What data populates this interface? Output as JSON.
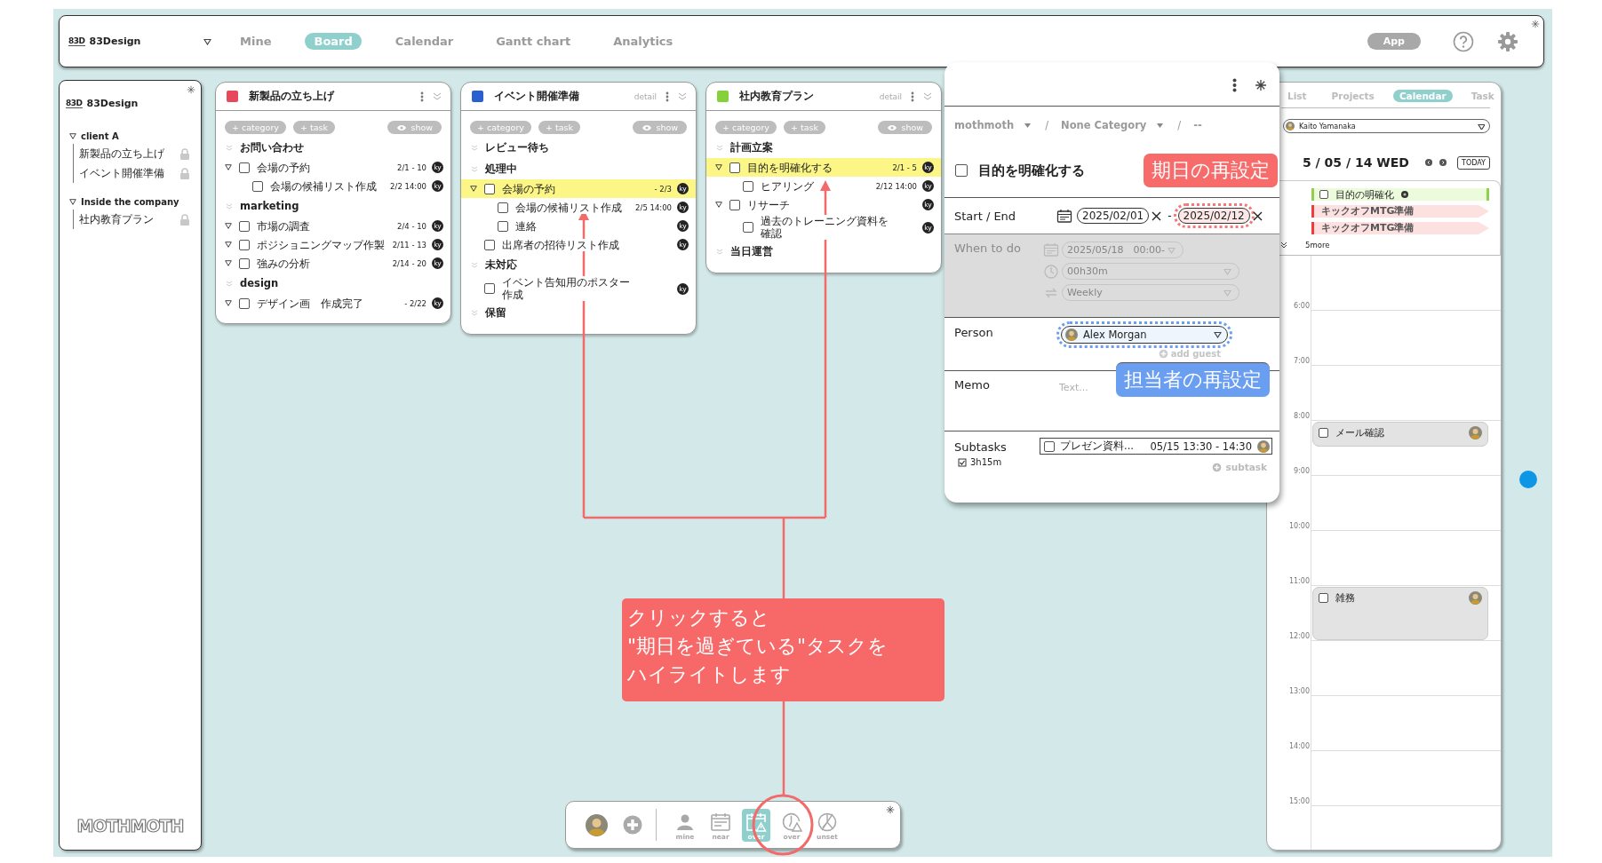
{
  "top_bar": {
    "logo_mark": "83D",
    "workspace": "83Design",
    "tabs": [
      {
        "label": "Mine",
        "selected": false
      },
      {
        "label": "Board",
        "selected": true
      },
      {
        "label": "Calendar",
        "selected": false
      },
      {
        "label": "Gantt chart",
        "selected": false
      },
      {
        "label": "Analytics",
        "selected": false
      }
    ],
    "app_button": "App"
  },
  "sidebar": {
    "logo_mark": "83D",
    "title": "83Design",
    "groups": [
      {
        "label": "client A",
        "expanded": true,
        "children": [
          {
            "label": "新製品の立ち上げ",
            "locked": true
          },
          {
            "label": "イベント開催準備",
            "locked": true
          }
        ]
      },
      {
        "label": "Inside the company",
        "expanded": true,
        "children": [
          {
            "label": "社内教育プラン",
            "locked": true
          }
        ]
      }
    ],
    "footer_logo": "MOTHMOTH"
  },
  "boards": [
    {
      "title": "新製品の立ち上げ",
      "color": "#e8485c",
      "buttons": [
        "+ category",
        "+ task"
      ],
      "show_button": "show",
      "sections": [
        {
          "title": "お問い合わせ",
          "tasks": [
            {
              "title": "会場の予約",
              "date": "2/1 - 10",
              "avatar": "ky",
              "toggle": true,
              "highlighted": false,
              "children": [
                {
                  "title": "会場の候補リスト作成",
                  "date": "2/2 14:00",
                  "avatar": "ky",
                  "toggle": false,
                  "highlighted": false
                }
              ]
            }
          ]
        },
        {
          "title": "marketing",
          "tasks": [
            {
              "title": "市場の調査",
              "date": "2/4 - 10",
              "avatar": "ky",
              "toggle": true,
              "highlighted": false
            },
            {
              "title": "ポジショニングマップ作製",
              "date": "2/11 - 13",
              "avatar": "ky",
              "toggle": true,
              "highlighted": false
            },
            {
              "title": "強みの分析",
              "date": "2/14 - 20",
              "avatar": "ky",
              "toggle": true,
              "highlighted": false
            }
          ]
        },
        {
          "title": "design",
          "tasks": [
            {
              "title": "デザイン画　作成完了",
              "date": "- 2/22",
              "avatar": "ky",
              "toggle": true,
              "highlighted": false
            }
          ]
        }
      ]
    },
    {
      "title": "イベント開催準備",
      "color": "#2a5fcf",
      "detail": "detail",
      "buttons": [
        "+ category",
        "+ task"
      ],
      "show_button": "show",
      "sections": [
        {
          "title": "レビュー待ち"
        },
        {
          "title": "処理中",
          "tasks": [
            {
              "title": "会場の予約",
              "date": "- 2/3",
              "avatar": "ky",
              "toggle": true,
              "highlighted": true,
              "children": [
                {
                  "title": "会場の候補リスト作成",
                  "date": "2/5 14:00",
                  "avatar": "ky",
                  "toggle": false,
                  "highlighted": false
                },
                {
                  "title": "連絡",
                  "avatar": "ky",
                  "toggle": false,
                  "highlighted": false
                }
              ]
            },
            {
              "title": "出席者の招待リスト作成",
              "avatar": "ky",
              "toggle": false,
              "highlighted": false
            }
          ]
        },
        {
          "title": "未対応",
          "tasks": [
            {
              "title": "イベント告知用のポスター作成",
              "avatar": "ky",
              "toggle": false,
              "highlighted": false
            }
          ]
        },
        {
          "title": "保留"
        }
      ]
    },
    {
      "title": "社内教育プラン",
      "color": "#84d13c",
      "detail": "detail",
      "buttons": [
        "+ category",
        "+ task"
      ],
      "show_button": "show",
      "sections": [
        {
          "title": "計画立案",
          "tasks": [
            {
              "title": "目的を明確化する",
              "date": "2/1 - 5",
              "avatar": "ky",
              "toggle": true,
              "highlighted": true,
              "children": [
                {
                  "title": "ヒアリング",
                  "date": "2/12 14:00",
                  "avatar": "ky",
                  "toggle": false,
                  "highlighted": false
                }
              ]
            },
            {
              "title": "リサーチ",
              "avatar": "ky",
              "toggle": true,
              "highlighted": false,
              "children": [
                {
                  "title": "過去のトレーニング資料を確認",
                  "avatar": "ky",
                  "toggle": false,
                  "highlighted": false
                }
              ]
            }
          ]
        },
        {
          "title": "当日運営"
        }
      ]
    }
  ],
  "detail": {
    "breadcrumb": {
      "separator": "/",
      "items": [
        {
          "label": "mothmoth",
          "dropdown": true
        },
        {
          "label": "None Category",
          "dropdown": true
        },
        {
          "label": "--",
          "dropdown": false
        }
      ]
    },
    "task": {
      "title": "目的を明確化する",
      "checked": false
    },
    "start_end": {
      "label": "Start / End",
      "start": "2025/02/01",
      "separator": "-",
      "end": "2025/02/12",
      "end_annotated": true
    },
    "when": {
      "label": "When to do",
      "disabled": true,
      "fields": [
        {
          "kind": "date",
          "value": "2025/05/18　00:00-"
        },
        {
          "kind": "duration",
          "value": "00h30m"
        },
        {
          "kind": "repeat",
          "value": "Weekly"
        }
      ]
    },
    "person": {
      "label": "Person",
      "value": "Alex Morgan",
      "annotated": true,
      "add_guest": "add guest"
    },
    "memo": {
      "label": "Memo",
      "placeholder": "Text..."
    },
    "subtasks": {
      "label": "Subtasks",
      "total": "3h15m",
      "items": [
        {
          "title": "プレゼン資料...",
          "time": "05/15 13:30 - 14:30",
          "checked": false
        }
      ],
      "add_button": "subtask"
    }
  },
  "calendar": {
    "tabs": [
      {
        "label": "List",
        "selected": false
      },
      {
        "label": "Projects",
        "selected": false
      },
      {
        "label": "Calendar",
        "selected": true
      },
      {
        "label": "Task",
        "selected": false
      }
    ],
    "user": "Kaito Yamanaka",
    "date": "5 / 05 / 14 WED",
    "today_button": "TODAY",
    "all_day": [
      {
        "kind": "task",
        "title": "目的の明確化",
        "color": "#8fd14f",
        "checked": false
      },
      {
        "kind": "event",
        "title": "キックオフMTG準備",
        "color": "#f03c3c"
      },
      {
        "kind": "event",
        "title": "キックオフMTG準備",
        "color": "#f03c3c"
      }
    ],
    "more": "5more",
    "hours": [
      {
        "label": "6:00"
      },
      {
        "label": "7:00"
      },
      {
        "label": "8:00",
        "events": [
          {
            "kind": "half",
            "title": "メール確認",
            "checked": false
          }
        ]
      },
      {
        "label": "9:00"
      },
      {
        "label": "10:00"
      },
      {
        "label": "11:00",
        "events": [
          {
            "kind": "hour",
            "title": "雑務",
            "checked": false
          }
        ]
      },
      {
        "label": "12:00"
      },
      {
        "label": "13:00"
      },
      {
        "label": "14:00"
      },
      {
        "label": "15:00"
      }
    ]
  },
  "toolbar": {
    "filters": [
      {
        "kind": "mine",
        "label": "mine",
        "selected": false
      },
      {
        "kind": "near",
        "label": "near",
        "selected": false
      },
      {
        "kind": "over",
        "label": "over",
        "selected": true
      },
      {
        "kind": "time_over",
        "label": "over",
        "selected": false
      },
      {
        "kind": "unset",
        "label": "unset",
        "selected": false
      }
    ]
  },
  "callout": {
    "lines": [
      "クリックすると",
      "\"期日を過ぎている\"タスクを",
      "ハイライトします"
    ]
  },
  "annotations": [
    {
      "kind": "due",
      "text": "期日の再設定",
      "color": "#f76b6b"
    },
    {
      "kind": "person",
      "text": "担当者の再設定",
      "color": "#6a9ef0"
    }
  ]
}
